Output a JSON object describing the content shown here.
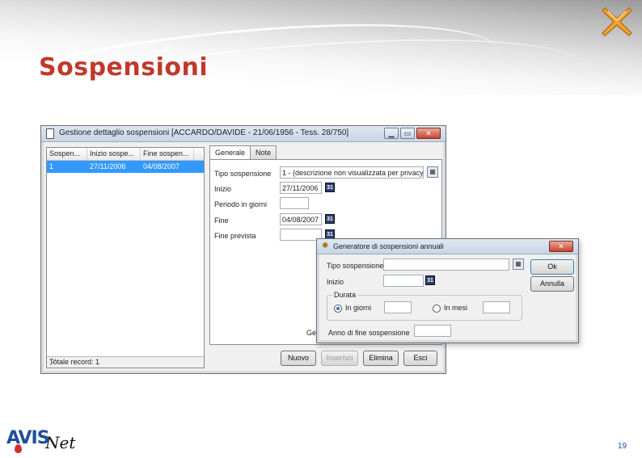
{
  "slide": {
    "title": "Sospensioni",
    "page_number": "19",
    "logo_main": "AVIS",
    "logo_suffix": "Net"
  },
  "window": {
    "title": "Gestione dettaglio sospensioni [ACCARDO/DAVIDE - 21/06/1956 - Tess. 28/750]",
    "controls": {
      "minimize": "▁",
      "maximize": "▭",
      "close": "✕"
    },
    "list": {
      "columns": [
        "Sospen...",
        "Inizio sospe...",
        "Fine sospen..."
      ],
      "rows": [
        [
          "1",
          "27/11/2006",
          "04/08/2007"
        ]
      ],
      "footer": "Totale record: 1"
    },
    "tabs": [
      "Generale",
      "Note"
    ],
    "form": {
      "tipo_label": "Tipo sospensione",
      "tipo_value": "1 - (descrizione non visualizzata per privacy)",
      "inizio_label": "Inizio",
      "inizio_value": "27/11/2006",
      "periodo_label": "Periodo in giorni",
      "periodo_value": "",
      "fine_label": "Fine",
      "fine_value": "04/08/2007",
      "fine_prevista_label": "Fine prevista",
      "fine_prevista_value": "",
      "generatore_stub": "Ge",
      "calendar_glyph": "31"
    },
    "buttons": {
      "nuovo": "Nuovo",
      "inserisci": "Inserisci",
      "elimina": "Elimina",
      "esci": "Esci"
    }
  },
  "dialog": {
    "title": "Generatore di sospensioni annuali",
    "close": "✕",
    "tipo_label": "Tipo sospensione",
    "tipo_value": "",
    "inizio_label": "Inizio",
    "inizio_value": "",
    "durata_label": "Durata",
    "radio_giorni_label": "In giorni",
    "radio_mesi_label": "In mesi",
    "radio_selected": "In giorni",
    "giorni_value": "",
    "mesi_value": "",
    "anno_label": "Anno di fine sospensione",
    "anno_value": "",
    "ok_label": "Ok",
    "annulla_label": "Annulla",
    "calendar_glyph": "31"
  },
  "colors": {
    "title_red": "#c0392b",
    "selection_blue": "#3399ff",
    "logo_blue": "#1f4e9b",
    "logo_drop": "#d32f2f"
  }
}
